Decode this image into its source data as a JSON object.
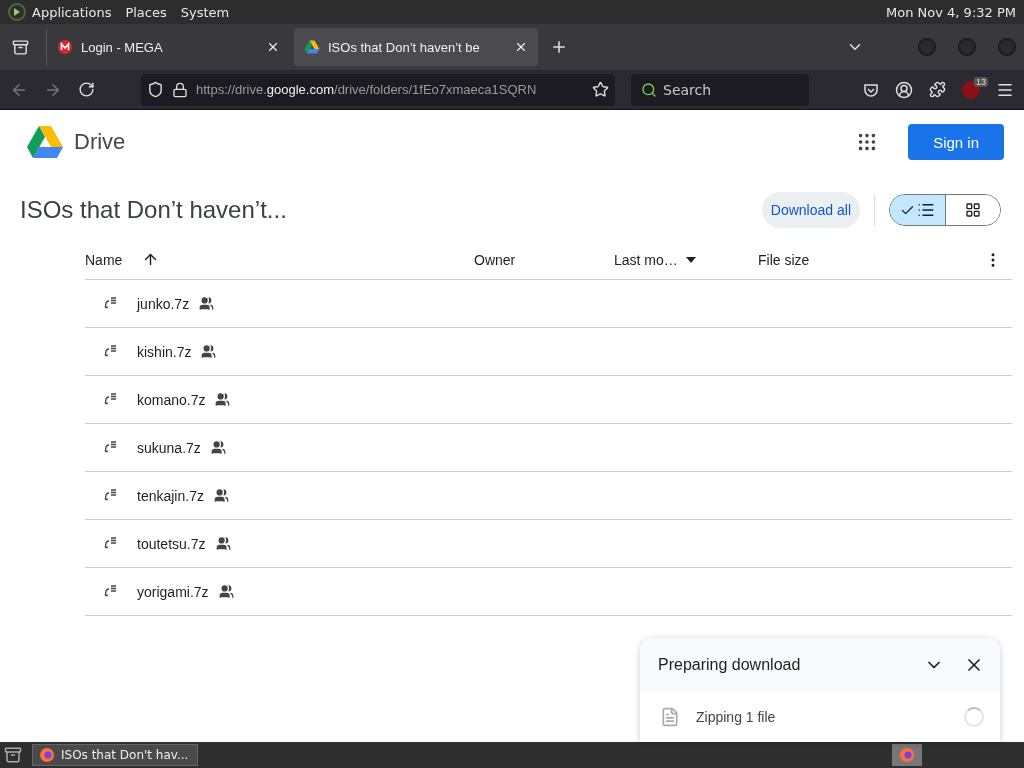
{
  "top_panel": {
    "menus": [
      "Applications",
      "Places",
      "System"
    ],
    "clock": "Mon Nov 4,  9:32 PM"
  },
  "tabs": [
    {
      "title": "Login - MEGA",
      "selected": false,
      "kind": "mega"
    },
    {
      "title": "ISOs that Don’t haven’t be",
      "selected": true,
      "kind": "drive"
    }
  ],
  "address_bar": {
    "scheme": "https://drive.",
    "domain": "google.com",
    "path": "/drive/folders/1fEo7xmaeca1SQRN"
  },
  "search": {
    "placeholder": "Search"
  },
  "extension_badge": "13",
  "drive": {
    "logo_text": "Drive",
    "sign_in": "Sign in",
    "folder_title": "ISOs that Don’t haven’t...",
    "download_all": "Download all",
    "view_toggle": [
      {
        "kind": "list",
        "selected": true
      },
      {
        "kind": "grid",
        "selected": false
      }
    ]
  },
  "table": {
    "columns": [
      {
        "label": "Name",
        "kind": "sorted"
      },
      {
        "label": "Owner",
        "kind": "plain"
      },
      {
        "label": "Last mo…",
        "kind": "menu"
      },
      {
        "label": "File size",
        "kind": "plain"
      }
    ],
    "rows": [
      {
        "name": "junko.7z",
        "shared": true
      },
      {
        "name": "kishin.7z",
        "shared": true
      },
      {
        "name": "komano.7z",
        "shared": true
      },
      {
        "name": "sukuna.7z",
        "shared": true
      },
      {
        "name": "tenkajin.7z",
        "shared": true
      },
      {
        "name": "toutetsu.7z",
        "shared": true
      },
      {
        "name": "yorigami.7z",
        "shared": true
      }
    ]
  },
  "download_panel": {
    "title": "Preparing download",
    "status": "Zipping 1 file"
  },
  "taskbar": {
    "windows": [
      {
        "title": "ISOs that Don't hav...",
        "selected": true
      }
    ]
  }
}
